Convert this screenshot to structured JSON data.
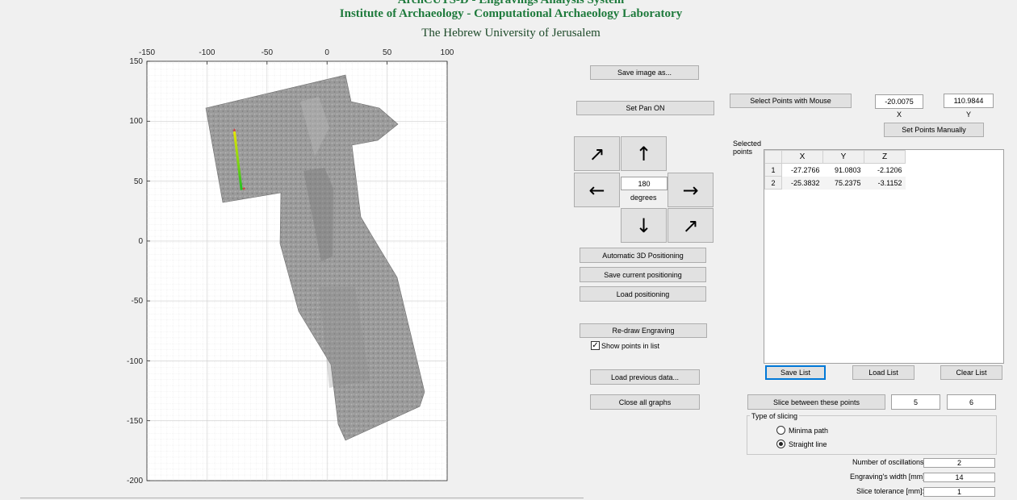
{
  "header": {
    "line1": "ArchCUTS-D - Engravings Analysis System",
    "line2": "Institute of Archaeology - Computational Archaeology Laboratory",
    "line3": "The Hebrew University of Jerusalem"
  },
  "plot": {
    "x_ticks": [
      "-150",
      "-100",
      "-50",
      "0",
      "50",
      "100"
    ],
    "y_ticks": [
      "150",
      "100",
      "50",
      "0",
      "-50",
      "-100",
      "-150",
      "-200"
    ],
    "line_color_start": "#e8e800",
    "line_color_end": "#22c022",
    "marker_color": "#e02020"
  },
  "controls": {
    "save_image": "Save image as...",
    "set_pan": "Set Pan  ON",
    "rotate_value": "180",
    "rotate_unit": "degrees",
    "arrow_up": "↑",
    "arrow_down": "↓",
    "arrow_left": "←",
    "arrow_right": "→",
    "rotate_ccw": "↗",
    "rotate_cw": "↗",
    "auto_3d": "Automatic 3D Positioning",
    "save_positioning": "Save current positioning",
    "load_positioning": "Load positioning",
    "redraw": "Re-draw Engraving",
    "show_points_label": "Show points in list",
    "show_points_checked": "✓",
    "load_previous": "Load previous data...",
    "close_graphs": "Close all graphs"
  },
  "points_panel": {
    "select_mouse": "Select Points with Mouse",
    "x_value": "-20.0075",
    "x_label": "X",
    "y_value": "110.9844",
    "y_label": "Y",
    "set_manual": "Set Points Manually",
    "selected_label": "Selected points",
    "columns": [
      "X",
      "Y",
      "Z"
    ],
    "rows": [
      {
        "idx": "1",
        "x": "-27.2766",
        "y": "91.0803",
        "z": "-2.1206"
      },
      {
        "idx": "2",
        "x": "-25.3832",
        "y": "75.2375",
        "z": "-3.1152"
      }
    ],
    "save_list": "Save List",
    "load_list": "Load List",
    "clear_list": "Clear List"
  },
  "slicing": {
    "slice_button": "Slice between these points",
    "from_value": "5",
    "to_value": "6",
    "group_title": "Type of slicing",
    "option_minima": "Minima path",
    "option_straight": "Straight line",
    "selected": "Straight line",
    "oscillations_label": "Number of oscillations:",
    "oscillations_value": "2",
    "width_label": "Engraving's width [mm]:",
    "width_value": "14",
    "tolerance_label": "Slice tolerance [mm]:",
    "tolerance_value": "1"
  }
}
